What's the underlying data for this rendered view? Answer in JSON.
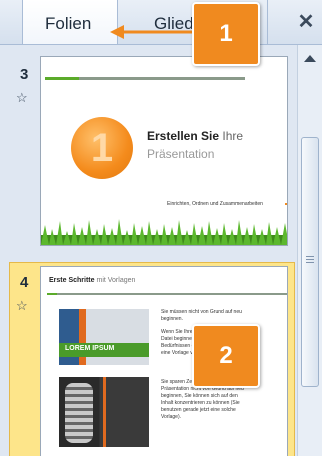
{
  "tabs": {
    "slides_label": "Folien",
    "outline_label": "Gliederung",
    "close_glyph": "✕"
  },
  "callouts": [
    "1",
    "2"
  ],
  "slides": [
    {
      "number": "3",
      "title_bold": "Erstellen Sie",
      "title_light": "Ihre",
      "subtitle": "Präsentation",
      "big_digit": "1",
      "footer": "Einrichten, Ordnen und Zusammenarbeiten"
    },
    {
      "number": "4",
      "title_bold": "Erste Schritte",
      "title_light": "mit Vorlagen",
      "image_label": "LOREM IPSUM",
      "text_1": "Sie müssen nicht von Grund auf neu beginnen.",
      "text_2": "Wenn Sie Ihre Präsentation aus einer Datei beginnen möchten, die Ihren Bedürfnissen entspricht, können Sie eine Vorlage verwenden.",
      "text_3": "Sie sparen Zeit und müssen Ihre Präsentation nicht von Grund auf neu beginnen, Sie können sich auf den Inhalt konzentrieren zu können (Sie benutzen gerade jetzt eine solche Vorlage)."
    }
  ],
  "colors": {
    "accent_orange": "#f08a1f",
    "selected_slide": "#fde58a",
    "panel_bg": "#dfe7f2"
  }
}
